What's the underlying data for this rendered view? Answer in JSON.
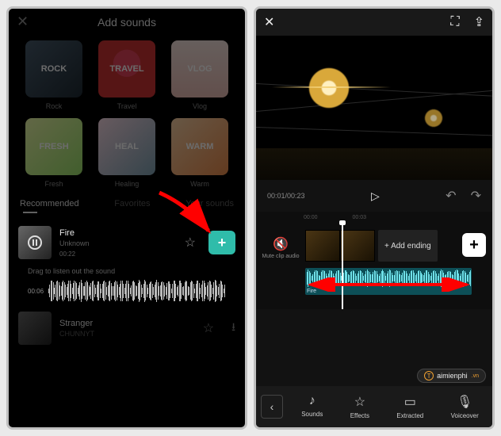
{
  "left": {
    "title": "Add sounds",
    "categories": [
      {
        "label": "Rock",
        "overlay": "ROCK"
      },
      {
        "label": "Travel",
        "overlay": "TRAVEL"
      },
      {
        "label": "Vlog",
        "overlay": "VLOG"
      },
      {
        "label": "Fresh",
        "overlay": "FRESH"
      },
      {
        "label": "Healing",
        "overlay": "HEAL"
      },
      {
        "label": "Warm",
        "overlay": "WARM"
      }
    ],
    "tabs": {
      "recommended": "Recommended",
      "favorites": "Favorites",
      "yoursounds": "Your sounds"
    },
    "tracks": [
      {
        "name": "Fire",
        "artist": "Unknown",
        "duration": "00:22"
      },
      {
        "name": "Stranger",
        "artist": "CHUNNYT"
      }
    ],
    "drag_hint": "Drag to listen out the sound",
    "wave_time": "00:06"
  },
  "right": {
    "time": "00:01/00:23",
    "ruler": [
      "00:00",
      "00:03"
    ],
    "muteclip": {
      "label": "Mute clip audio"
    },
    "audio_label": "Fire",
    "add_ending": "+ Add ending",
    "watermark": {
      "text": "aimienphi",
      "suffix": ".vn",
      "badge": "T"
    },
    "toolbar": [
      {
        "label": "Sounds"
      },
      {
        "label": "Effects"
      },
      {
        "label": "Extracted"
      },
      {
        "label": "Voiceover"
      }
    ]
  }
}
